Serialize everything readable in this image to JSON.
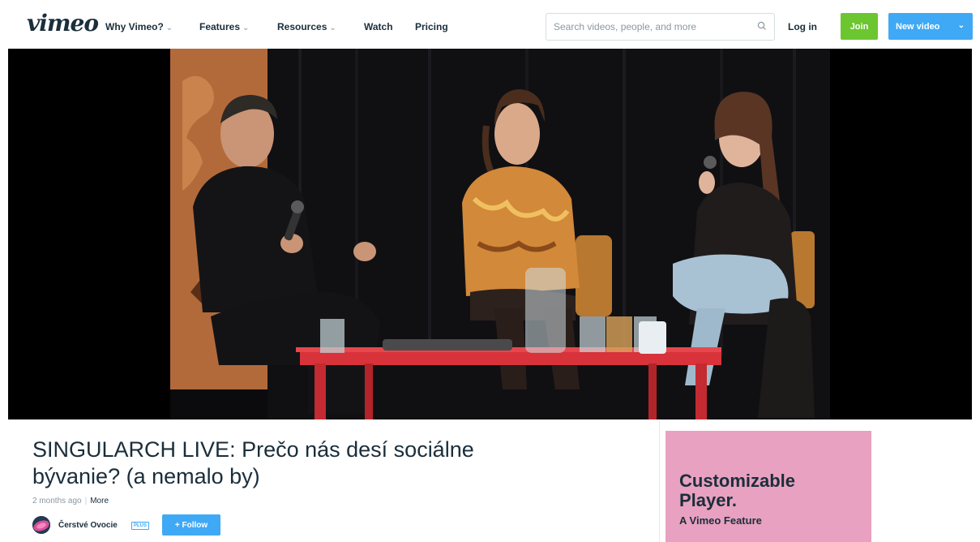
{
  "header": {
    "logo": "vimeo",
    "nav": [
      {
        "label": "Why Vimeo?",
        "dropdown": true
      },
      {
        "label": "Features",
        "dropdown": true
      },
      {
        "label": "Resources",
        "dropdown": true
      },
      {
        "label": "Watch",
        "dropdown": false
      },
      {
        "label": "Pricing",
        "dropdown": false
      }
    ],
    "search": {
      "placeholder": "Search videos, people, and more",
      "value": "",
      "icon": "magnifier-icon"
    },
    "login_label": "Log in",
    "join_label": "Join",
    "new_video_label": "New video"
  },
  "video": {
    "title": "SINGULARCH LIVE: Prečo nás desí sociálne bývanie? (a nemalo by)",
    "posted": "2 months ago",
    "more_label": "More",
    "owner": {
      "name": "Čerstvé Ovocie",
      "badge": "PLUS"
    },
    "follow_label": "+ Follow"
  },
  "sidebar_ad": {
    "headline_line1": "Customizable",
    "headline_line2": "Player.",
    "sub": "A Vimeo Feature"
  },
  "colors": {
    "brand_text": "#1a2e3b",
    "join_green": "#6cc62f",
    "primary_blue": "#3fa9f5",
    "ad_pink": "#e8a1c0"
  }
}
